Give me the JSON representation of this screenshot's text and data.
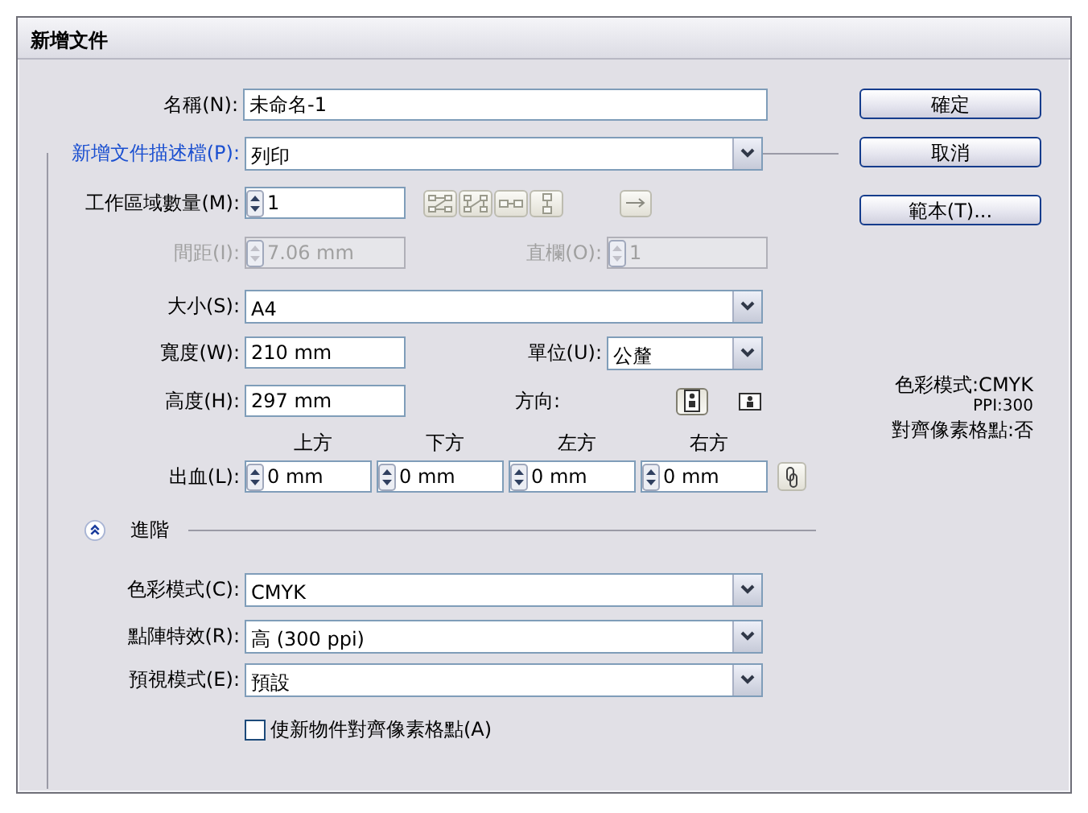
{
  "window": {
    "title": "新增文件"
  },
  "name": {
    "label": "名稱(N):",
    "value": "未命名-1"
  },
  "profile": {
    "label": "新增文件描述檔(P):",
    "value": "列印"
  },
  "artboards": {
    "label": "工作區域數量(M):",
    "value": "1"
  },
  "spacing": {
    "label": "間距(I):",
    "value": "7.06 mm",
    "disabled": true
  },
  "columns": {
    "label": "直欄(O):",
    "value": "1",
    "disabled": true
  },
  "size": {
    "label": "大小(S):",
    "value": "A4"
  },
  "width": {
    "label": "寬度(W):",
    "value": "210 mm"
  },
  "units": {
    "label": "單位(U):",
    "value": "公釐"
  },
  "height": {
    "label": "高度(H):",
    "value": "297 mm"
  },
  "orientation": {
    "label": "方向:",
    "options": [
      {
        "kind": "portrait",
        "selected": true
      },
      {
        "kind": "landscape",
        "selected": false
      }
    ]
  },
  "bleed": {
    "label": "出血(L):",
    "fields": [
      {
        "heading": "上方",
        "value": "0 mm"
      },
      {
        "heading": "下方",
        "value": "0 mm"
      },
      {
        "heading": "左方",
        "value": "0 mm"
      },
      {
        "heading": "右方",
        "value": "0 mm"
      }
    ]
  },
  "advanced": {
    "label": "進階",
    "expanded": true
  },
  "color_mode": {
    "label": "色彩模式(C):",
    "value": "CMYK"
  },
  "raster_effects": {
    "label": "點陣特效(R):",
    "value": "高 (300 ppi)"
  },
  "preview_mode": {
    "label": "預視模式(E):",
    "value": "預設"
  },
  "align_pixel": {
    "label": "使新物件對齊像素格點(A)",
    "checked": false
  },
  "buttons": [
    {
      "label": "確定"
    },
    {
      "label": "取消"
    },
    {
      "label": "範本(T)..."
    }
  ],
  "summary": [
    {
      "text": "色彩模式:CMYK",
      "kind": "large"
    },
    {
      "text": "PPI:300",
      "kind": "small"
    },
    {
      "text": "對齊像素格點:否",
      "kind": "large"
    }
  ]
}
